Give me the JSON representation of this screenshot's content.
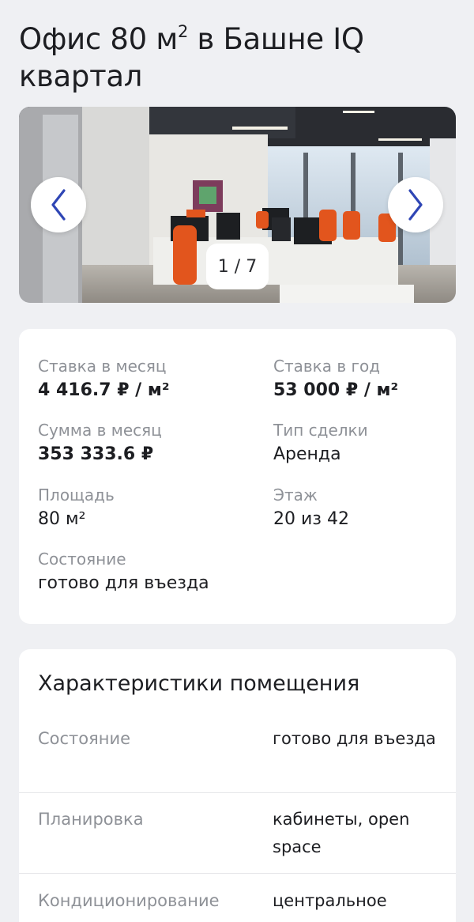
{
  "listing": {
    "title_main": "Офис 80 м",
    "title_sup": "2",
    "title_rest": " в Башне IQ квартал"
  },
  "gallery": {
    "counter": "1 / 7",
    "current_index": 1,
    "total": 7,
    "prev_icon": "chevron-left-icon",
    "next_icon": "chevron-right-icon",
    "arrow_color": "#2f46b5"
  },
  "summary": {
    "rate_month_label": "Ставка в месяц",
    "rate_month_value": "4 416.7 ₽ / м²",
    "rate_year_label": "Ставка в год",
    "rate_year_value": "53 000 ₽ / м²",
    "sum_month_label": "Сумма в месяц",
    "sum_month_value": "353 333.6 ₽",
    "deal_type_label": "Тип сделки",
    "deal_type_value": "Аренда",
    "area_label": "Площадь",
    "area_value": "80 м²",
    "floor_label": "Этаж",
    "floor_value": "20 из 42",
    "condition_label": "Состояние",
    "condition_value": "готово для въезда"
  },
  "characteristics": {
    "title": "Характеристики помещения",
    "rows": [
      {
        "key": "Состояние",
        "value": "готово для въезда"
      },
      {
        "key": "Планировка",
        "value": "кабинеты, open space"
      },
      {
        "key": "Кондиционирование",
        "value": "центральное"
      }
    ]
  },
  "colors": {
    "background": "#eff0f3",
    "card": "#ffffff",
    "label": "#8e9197",
    "text": "#1d1e22",
    "accent": "#2f46b5"
  }
}
